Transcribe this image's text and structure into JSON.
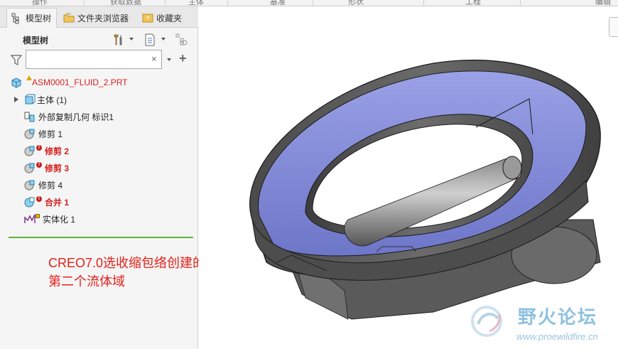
{
  "ribbon": {
    "groups": [
      "操作",
      "获取数据",
      "主体",
      "基准",
      "形状",
      "工程",
      "编辑"
    ]
  },
  "tabs": [
    {
      "label": "模型树",
      "icon": "model-tree-icon",
      "active": true
    },
    {
      "label": "文件夹浏览器",
      "icon": "folder-browser-icon",
      "active": false
    },
    {
      "label": "收藏夹",
      "icon": "favorites-icon",
      "active": false
    }
  ],
  "tree_header": {
    "title": "模型树",
    "settings_icon": "tools-icon",
    "show_icon": "list-columns-icon",
    "filter_icon": "tree-filter-icon"
  },
  "search": {
    "value": "",
    "placeholder": "",
    "clear": "×",
    "add": "+"
  },
  "tree": {
    "root": {
      "label": "ASM0001_FLUID_2.PRT",
      "warning": true
    },
    "items": [
      {
        "label": "主体 (1)",
        "icon": "body-icon",
        "expandable": true,
        "status": "ok"
      },
      {
        "label": "外部复制几何 标识1",
        "icon": "copy-geometry-icon",
        "status": "ok"
      },
      {
        "label": "修剪 1",
        "icon": "trim-icon",
        "status": "ok"
      },
      {
        "label": "修剪 2",
        "icon": "trim-icon",
        "status": "error"
      },
      {
        "label": "修剪 3",
        "icon": "trim-icon",
        "status": "error"
      },
      {
        "label": "修剪 4",
        "icon": "trim-icon",
        "status": "ok"
      },
      {
        "label": "合并 1",
        "icon": "merge-icon",
        "status": "error"
      },
      {
        "label": "实体化 1",
        "icon": "solidify-icon",
        "status": "warning"
      }
    ],
    "error_glyph": "!"
  },
  "annotation": {
    "line1": "CREO7.0选收缩包络创建的",
    "line2": "第二个流体域"
  },
  "watermark": {
    "title": "野火论坛",
    "url": "www.proewildfire.cn"
  },
  "colors": {
    "error_red": "#d62020",
    "annotation_red": "#e2221c",
    "insert_line": "#5bb53a",
    "model_gray": "#5d5d5d",
    "model_blue": "#8c94df"
  }
}
